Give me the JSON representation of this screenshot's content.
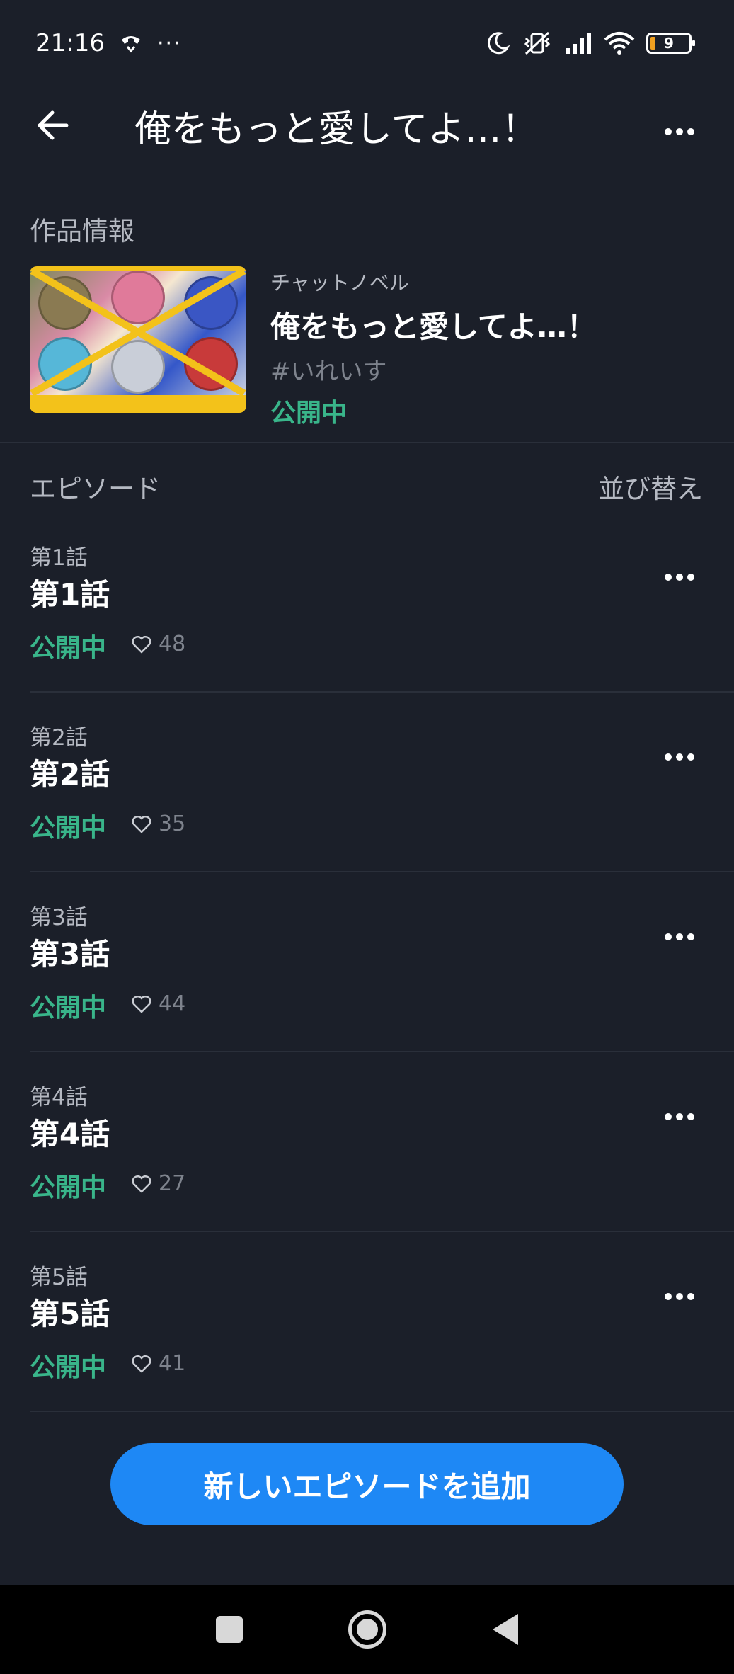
{
  "status_bar": {
    "time": "21:16",
    "extra": "···",
    "battery": "9",
    "icons": [
      "call-icon",
      "moon-icon",
      "vibrate-off-icon",
      "signal-icon",
      "wifi-icon",
      "battery-icon"
    ]
  },
  "app_bar": {
    "title": "俺をもっと愛してよ…！"
  },
  "work_info": {
    "section_label": "作品情報",
    "type": "チャットノベル",
    "title": "俺をもっと愛してよ…！",
    "tag": "#いれいす",
    "status": "公開中"
  },
  "episodes_section": {
    "label": "エピソード",
    "sort_label": "並び替え",
    "items": [
      {
        "subtitle": "第1話",
        "title": "第1話",
        "status": "公開中",
        "likes": "48"
      },
      {
        "subtitle": "第2話",
        "title": "第2話",
        "status": "公開中",
        "likes": "35"
      },
      {
        "subtitle": "第3話",
        "title": "第3話",
        "status": "公開中",
        "likes": "44"
      },
      {
        "subtitle": "第4話",
        "title": "第4話",
        "status": "公開中",
        "likes": "27"
      },
      {
        "subtitle": "第5話",
        "title": "第5話",
        "status": "公開中",
        "likes": "41"
      }
    ]
  },
  "add_button": {
    "label": "新しいエピソードを追加"
  },
  "colors": {
    "background": "#1b1f29",
    "accent_blue": "#1e88f5",
    "status_green": "#39b58a",
    "muted_text": "#b5b9c2"
  }
}
